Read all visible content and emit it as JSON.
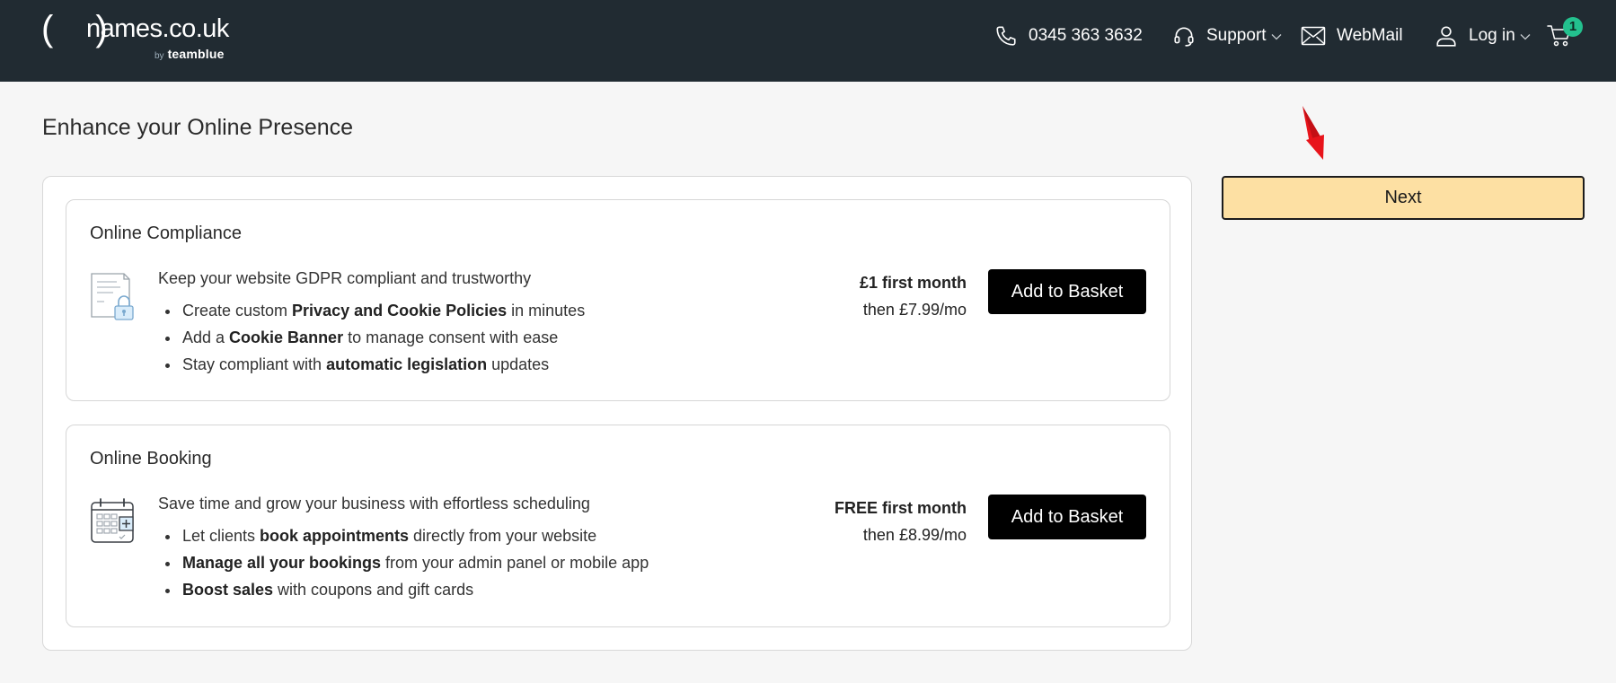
{
  "header": {
    "logo": {
      "brackets": "( )",
      "domain": "names.co.uk",
      "by": "by",
      "parent": "teamblue"
    },
    "phone": {
      "icon": "phone-icon",
      "label": "0345 363 3632"
    },
    "support": {
      "icon": "headset-icon",
      "label": "Support"
    },
    "webmail": {
      "icon": "envelope-icon",
      "label": "WebMail"
    },
    "login": {
      "icon": "user-icon",
      "label": "Log in"
    },
    "cart": {
      "icon": "cart-icon",
      "count": "1"
    }
  },
  "main": {
    "title": "Enhance your Online Presence",
    "next_label": "Next",
    "products": [
      {
        "title": "Online Compliance",
        "icon": "document-lock-icon",
        "description": "Keep your website GDPR compliant and trustworthy",
        "bullets": [
          {
            "pre": "Create custom ",
            "bold": "Privacy and Cookie Policies",
            "post": " in minutes"
          },
          {
            "pre": "Add a ",
            "bold": "Cookie Banner",
            "post": " to manage consent with ease"
          },
          {
            "pre": "Stay compliant with ",
            "bold": "automatic legislation",
            "post": " updates"
          }
        ],
        "price_first": "£1 first month",
        "price_then": "then £7.99/mo",
        "button": "Add to Basket"
      },
      {
        "title": "Online Booking",
        "icon": "calendar-plus-icon",
        "description": "Save time and grow your business with effortless scheduling",
        "bullets": [
          {
            "pre": "Let clients ",
            "bold": "book appointments",
            "post": " directly from your website"
          },
          {
            "pre": "",
            "bold": "Manage all your bookings",
            "post": " from your admin panel or mobile app"
          },
          {
            "pre": "",
            "bold": "Boost sales",
            "post": " with coupons and gift cards"
          }
        ],
        "price_first": "FREE first month",
        "price_then": "then £8.99/mo",
        "button": "Add to Basket"
      }
    ]
  },
  "colors": {
    "header_bg": "#212b32",
    "next_bg": "#fde0a3",
    "badge_bg": "#23c18e",
    "arrow": "#e8141b"
  }
}
